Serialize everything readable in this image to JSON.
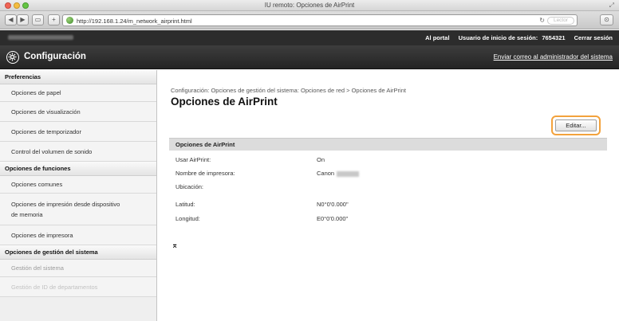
{
  "window": {
    "title": "IU remoto: Opciones de AirPrint",
    "url": "http://192.168.1.24/m_network_airprint.html",
    "reader_label": "Lector"
  },
  "topbar": {
    "portal_link": "Al portal",
    "login_label": "Usuario de inicio de sesión:",
    "login_user": "7654321",
    "logout_link": "Cerrar sesión"
  },
  "header": {
    "title": "Configuración",
    "mail_link": "Enviar correo al administrador del sistema"
  },
  "sidebar": {
    "sections": [
      {
        "label": "Preferencias",
        "items": [
          "Opciones de papel",
          "Opciones de visualización",
          "Opciones de temporizador",
          "Control del volumen de sonido"
        ]
      },
      {
        "label": "Opciones de funciones",
        "items": [
          "Opciones comunes",
          "Opciones de impresión desde dispositivo de memoria",
          "Opciones de impresora"
        ]
      },
      {
        "label": "Opciones de gestión del sistema",
        "items": [
          "Gestión del sistema",
          "Gestión de ID de departamentos"
        ]
      }
    ]
  },
  "main": {
    "breadcrumb": "Configuración: Opciones de gestión del sistema: Opciones de red > Opciones de AirPrint",
    "title": "Opciones de AirPrint",
    "edit_button": "Editar...",
    "section_title": "Opciones de AirPrint",
    "properties": [
      {
        "label": "Usar AirPrint:",
        "value": "On"
      },
      {
        "label": "Nombre de impresora:",
        "value": "Canon"
      },
      {
        "label": "Ubicación:",
        "value": ""
      },
      {
        "label": "Latitud:",
        "value": "N0°0'0.000\""
      },
      {
        "label": "Longitud:",
        "value": "E0°0'0.000\""
      }
    ],
    "top_link": "⌅"
  },
  "icons": {
    "config": "gear-icon",
    "top": "go-to-top-icon"
  },
  "colors": {
    "header_bg": "#2c2c2c",
    "edit_highlight": "#f3a23c",
    "sidebar_bg": "#efefef",
    "section_bg": "#dcdcdc"
  }
}
